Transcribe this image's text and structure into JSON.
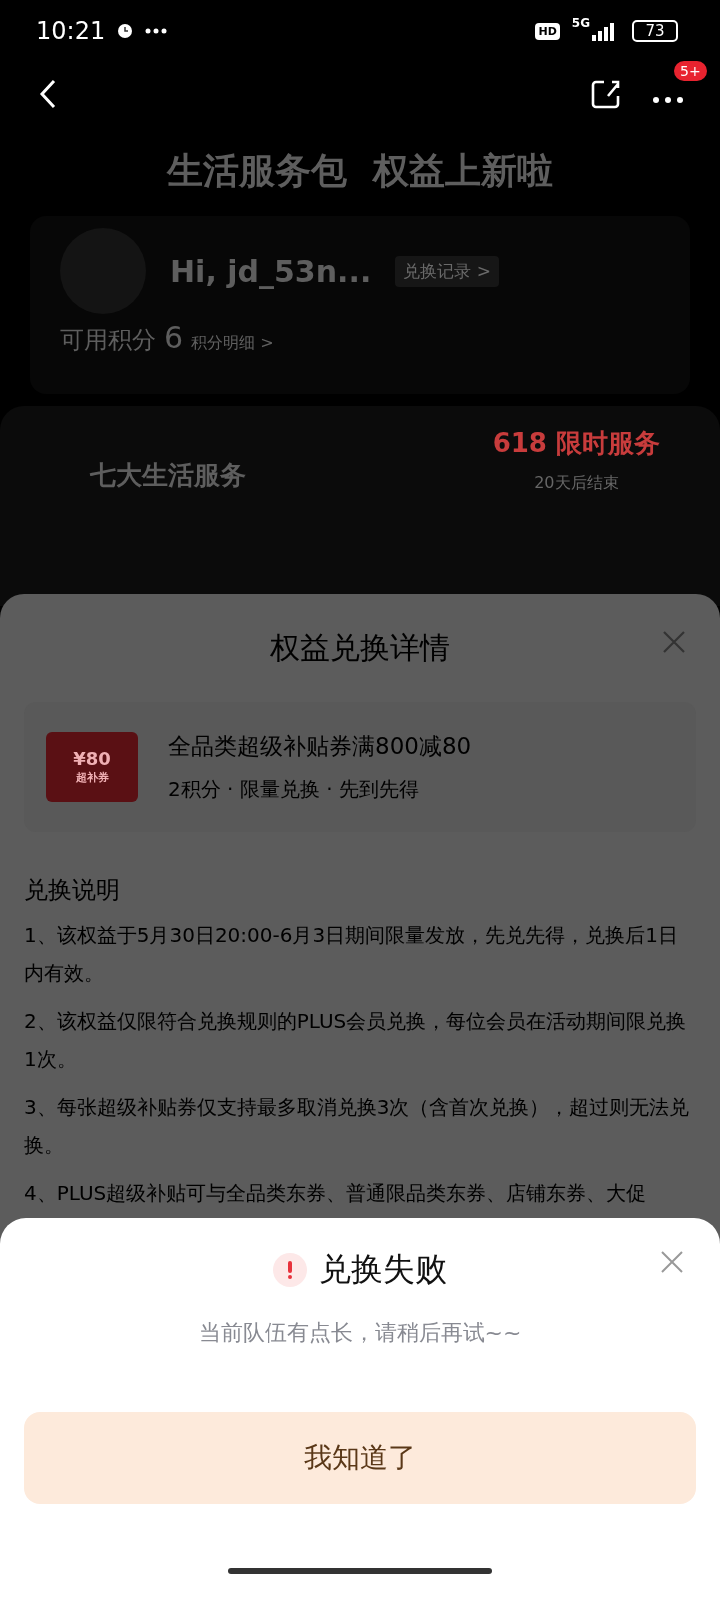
{
  "status_bar": {
    "time": "10:21",
    "hd": "HD",
    "network": "5G",
    "battery": "73"
  },
  "nav": {
    "badge": "5+"
  },
  "banner": {
    "title": "生活服务包  权益上新啦"
  },
  "account": {
    "greeting": "Hi, jd_53n...",
    "records_link": "兑换记录 >",
    "points_label": "可用积分",
    "points": "6",
    "details_link": "积分明细 >"
  },
  "services": {
    "title": "七大生活服务",
    "promo": "618 限时服务",
    "countdown": "20天后结束"
  },
  "sheet": {
    "title": "权益兑换详情",
    "coupon": {
      "amount": "¥80",
      "tag": "超补券",
      "name": "全品类超级补贴券满800减80",
      "meta": "2积分 · 限量兑换 · 先到先得"
    },
    "rules_title": "兑换说明",
    "rules": [
      "1、该权益于5月30日20:00-6月3日期间限量发放，先兑先得，兑换后1日内有效。",
      "2、该权益仅限符合兑换规则的PLUS会员兑换，每位会员在活动期间限兑换1次。",
      "3、每张超级补贴券仅支持最多取消兑换3次（含首次兑换），超过则无法兑换。",
      "4、PLUS超级补贴可与全品类东券、普通限品类东券、店铺东券、大促"
    ]
  },
  "dialog": {
    "title": "兑换失败",
    "message": "当前队伍有点长，请稍后再试~~",
    "button": "我知道了"
  }
}
